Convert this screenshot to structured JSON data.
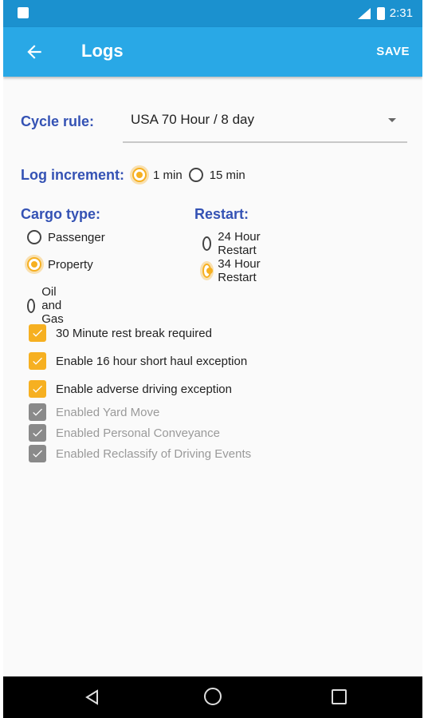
{
  "status_bar": {
    "time": "2:31"
  },
  "app_bar": {
    "title": "Logs",
    "save_label": "SAVE"
  },
  "cycle": {
    "label": "Cycle rule:",
    "value": "USA 70 Hour / 8 day"
  },
  "log_increment": {
    "label": "Log increment:",
    "options": [
      {
        "label": "1 min",
        "selected": true
      },
      {
        "label": "15 min",
        "selected": false
      }
    ]
  },
  "cargo": {
    "label": "Cargo type:",
    "options": [
      {
        "label": "Passenger",
        "selected": false
      },
      {
        "label": "Property",
        "selected": true
      },
      {
        "label": "Oil and Gas",
        "selected": false
      }
    ]
  },
  "restart": {
    "label": "Restart:",
    "options": [
      {
        "label": "24 Hour Restart",
        "selected": false
      },
      {
        "label": "34 Hour Restart",
        "selected": true
      }
    ]
  },
  "checkboxes": [
    {
      "label": "30 Minute rest break required",
      "checked": true,
      "enabled": true
    },
    {
      "label": "Enable 16 hour short haul exception",
      "checked": true,
      "enabled": true
    },
    {
      "label": "Enable adverse driving exception",
      "checked": true,
      "enabled": true
    },
    {
      "label": "Enabled Yard Move",
      "checked": true,
      "enabled": false
    },
    {
      "label": "Enabled Personal Conveyance",
      "checked": true,
      "enabled": false
    },
    {
      "label": "Enabled Reclassify of Driving Events",
      "checked": true,
      "enabled": false
    }
  ],
  "colors": {
    "accent": "#f6b021",
    "app_bar": "#29a8e6",
    "status_bar": "#1b91cf",
    "label": "#3452b4"
  }
}
